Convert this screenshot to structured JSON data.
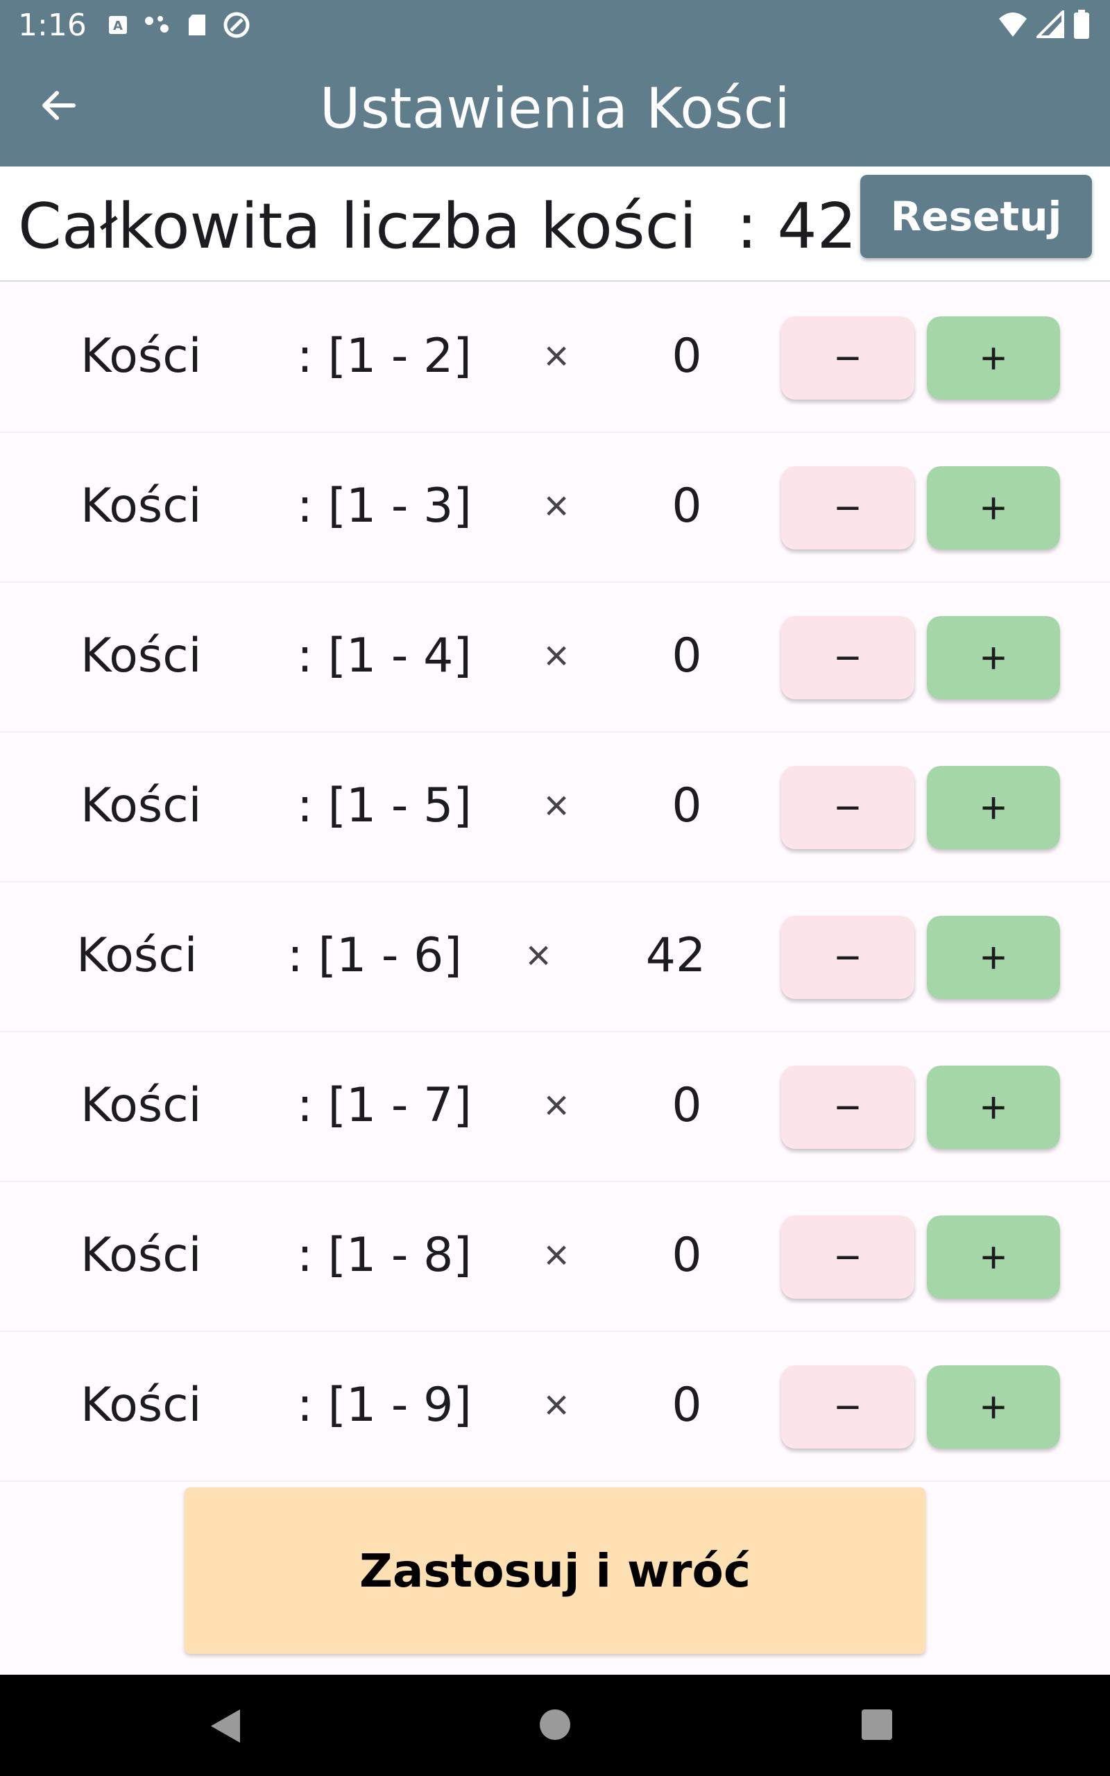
{
  "status_bar": {
    "time": "1:16",
    "icons": [
      "a-badge-icon",
      "dots-icon",
      "sd-card-icon",
      "at-sign-icon"
    ],
    "right_icons": [
      "wifi-icon",
      "signal-icon",
      "battery-icon"
    ]
  },
  "app_bar": {
    "title": "Ustawienia Kości",
    "back_icon": "arrow-left-icon"
  },
  "summary": {
    "total_label": "Całkowita liczba kości  : 42",
    "reset_label": "Resetuj"
  },
  "dice": [
    {
      "name": "Kości",
      "range": ": [1 - 2]",
      "times": "×",
      "count": "0",
      "minus": "−",
      "plus": "+"
    },
    {
      "name": "Kości",
      "range": ": [1 - 3]",
      "times": "×",
      "count": "0",
      "minus": "−",
      "plus": "+"
    },
    {
      "name": "Kości",
      "range": ": [1 - 4]",
      "times": "×",
      "count": "0",
      "minus": "−",
      "plus": "+"
    },
    {
      "name": "Kości",
      "range": ": [1 - 5]",
      "times": "×",
      "count": "0",
      "minus": "−",
      "plus": "+"
    },
    {
      "name": "Kości",
      "range": ": [1 - 6]",
      "times": "×",
      "count": "42",
      "minus": "−",
      "plus": "+"
    },
    {
      "name": "Kości",
      "range": ": [1 - 7]",
      "times": "×",
      "count": "0",
      "minus": "−",
      "plus": "+"
    },
    {
      "name": "Kości",
      "range": ": [1 - 8]",
      "times": "×",
      "count": "0",
      "minus": "−",
      "plus": "+"
    },
    {
      "name": "Kości",
      "range": ": [1 - 9]",
      "times": "×",
      "count": "0",
      "minus": "−",
      "plus": "+"
    }
  ],
  "apply_label": "Zastosuj i wróć",
  "colors": {
    "app_bar": "#607d8b",
    "minus_button": "#fbe4ea",
    "plus_button": "#a5d6a7",
    "apply_button": "#ffe0b2"
  }
}
